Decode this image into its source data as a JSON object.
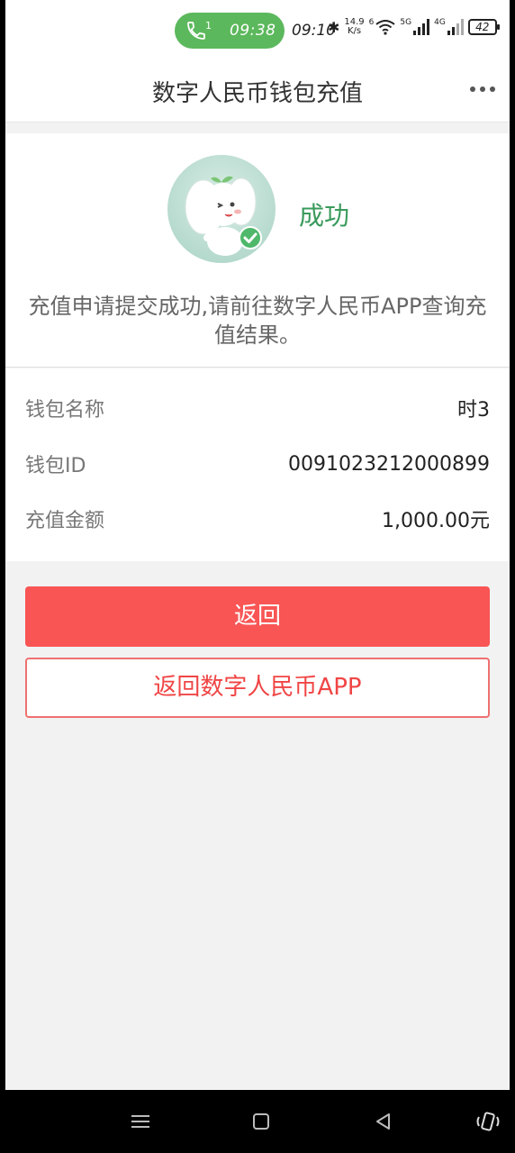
{
  "status_bar": {
    "call_time": "09:38",
    "call_sim": "1",
    "clock": "09:10",
    "net_speed_value": "14.9",
    "net_speed_unit": "K/s",
    "wifi_label": "6",
    "signal1_label": "5G",
    "signal2_label": "4G",
    "battery_level": "42"
  },
  "header": {
    "title": "数字人民币钱包充值",
    "more_icon": "more-dots-icon"
  },
  "result": {
    "status": "成功",
    "message": "充值申请提交成功,请前往数字人民币APP查询充值结果。"
  },
  "info": [
    {
      "label": "钱包名称",
      "value": "时3"
    },
    {
      "label": "钱包ID",
      "value": "0091023212000899"
    },
    {
      "label": "充值金额",
      "value": "1,000.00元"
    }
  ],
  "buttons": {
    "back": "返回",
    "back_to_app": "返回数字人民币APP"
  },
  "colors": {
    "accent_red": "#f95555",
    "success_green": "#3a9a5c",
    "call_pill_green": "#5cb85c"
  }
}
